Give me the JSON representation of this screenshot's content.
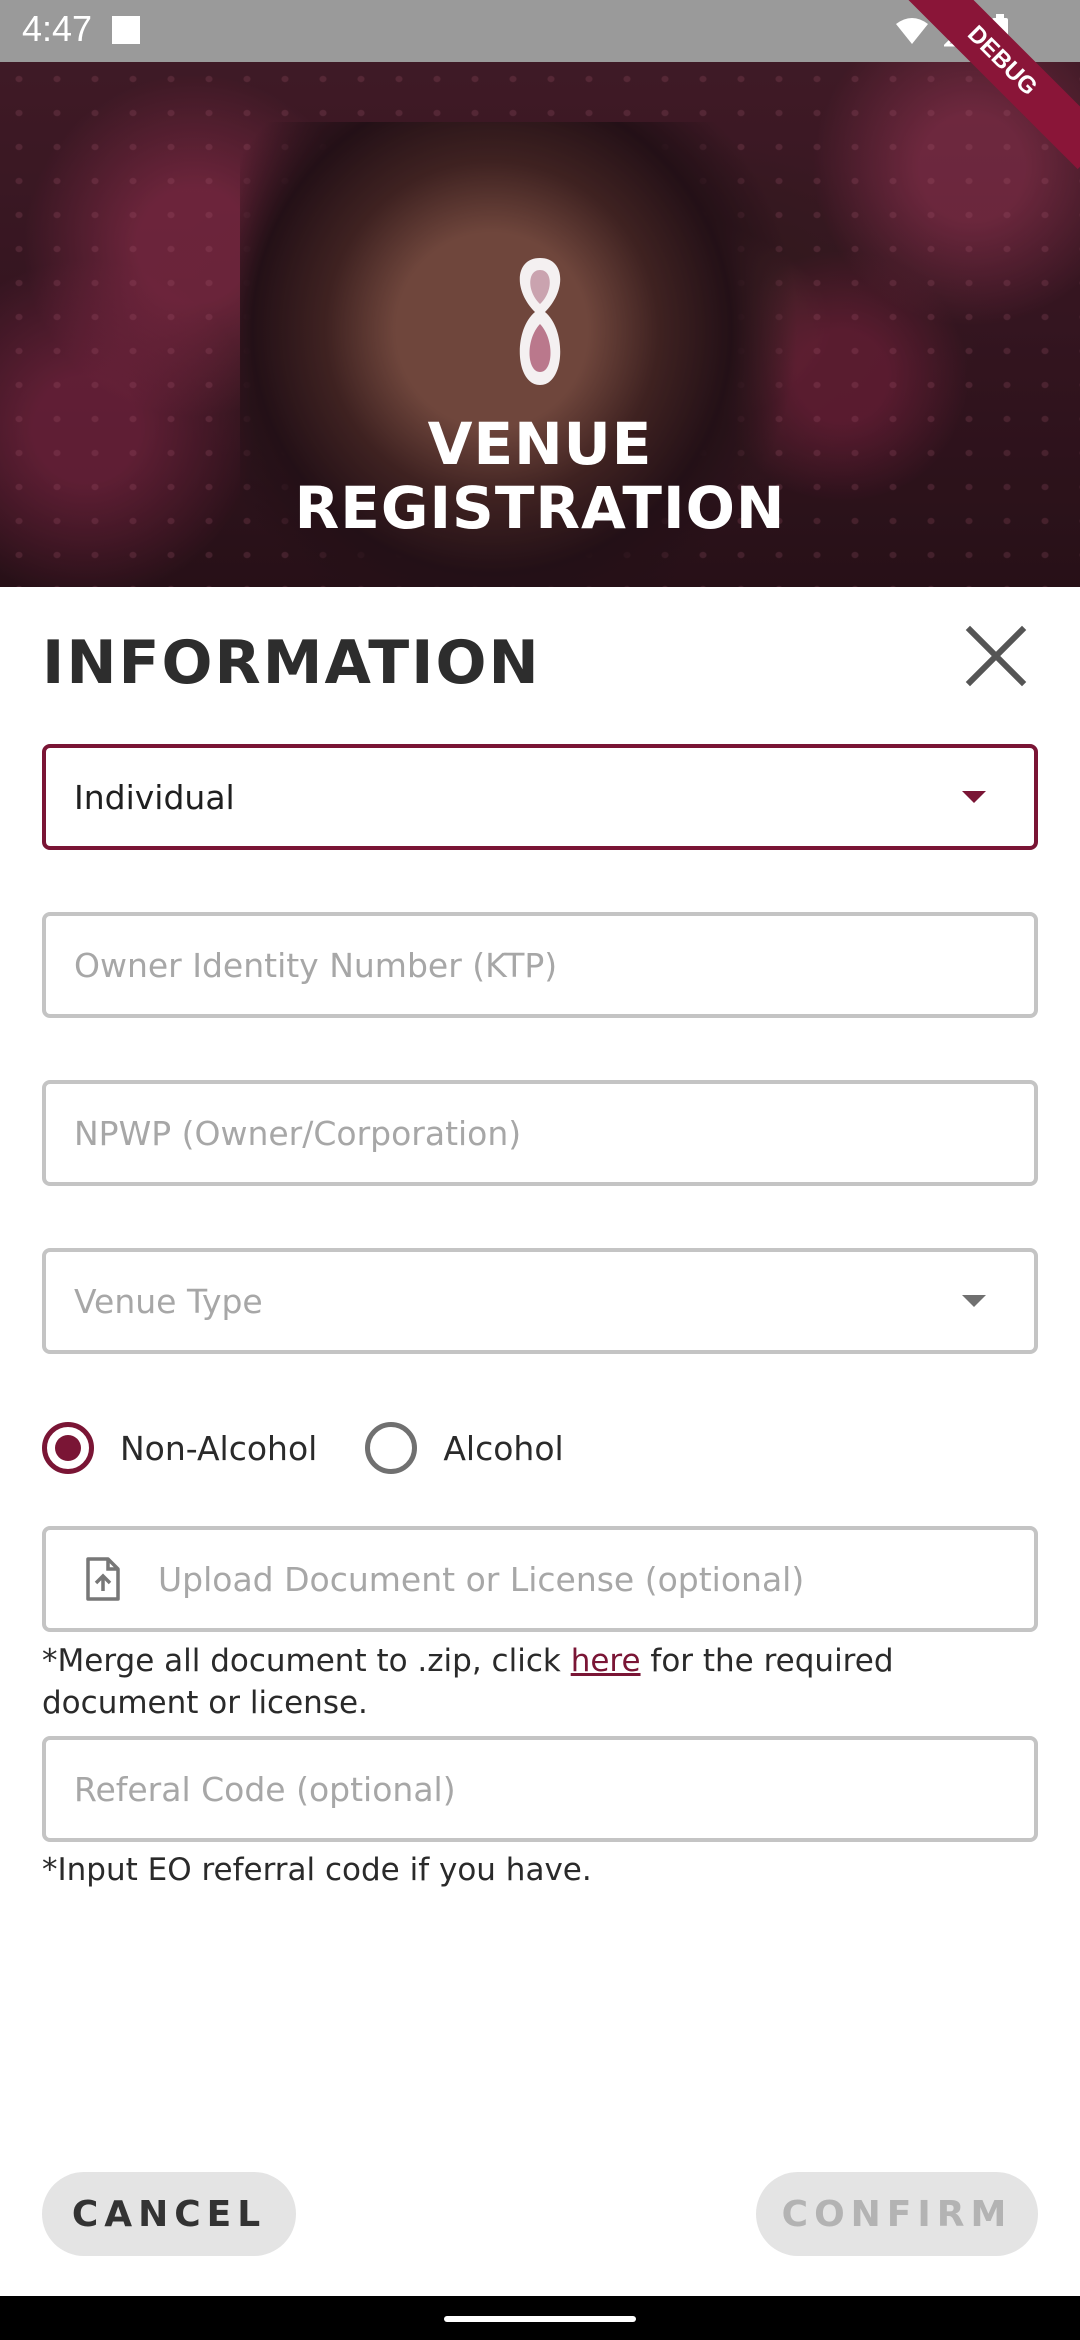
{
  "status_bar": {
    "time": "4:47",
    "debug_label": "DEBUG"
  },
  "hero": {
    "title_line1": "VENUE",
    "title_line2": "REGISTRATION"
  },
  "form": {
    "title": "INFORMATION",
    "type_select": {
      "value": "Individual"
    },
    "owner_id": {
      "placeholder": "Owner Identity Number (KTP)"
    },
    "npwp": {
      "placeholder": "NPWP (Owner/Corporation)"
    },
    "venue_type": {
      "placeholder": "Venue Type"
    },
    "alcohol_options": [
      {
        "label": "Non-Alcohol",
        "selected": true
      },
      {
        "label": "Alcohol",
        "selected": false
      }
    ],
    "upload": {
      "placeholder": "Upload Document or License (optional)"
    },
    "upload_hint": {
      "before": "*Merge all document to .zip, click ",
      "link": "here",
      "after": " for the required document or license."
    },
    "referral": {
      "placeholder": "Referal Code (optional)"
    },
    "referral_hint": "*Input EO referral code if you have."
  },
  "actions": {
    "cancel": "CANCEL",
    "confirm": "CONFIRM"
  },
  "colors": {
    "accent": "#7a1535",
    "disabled": "#b3b3b3",
    "button_bg": "#e4e4e4"
  }
}
